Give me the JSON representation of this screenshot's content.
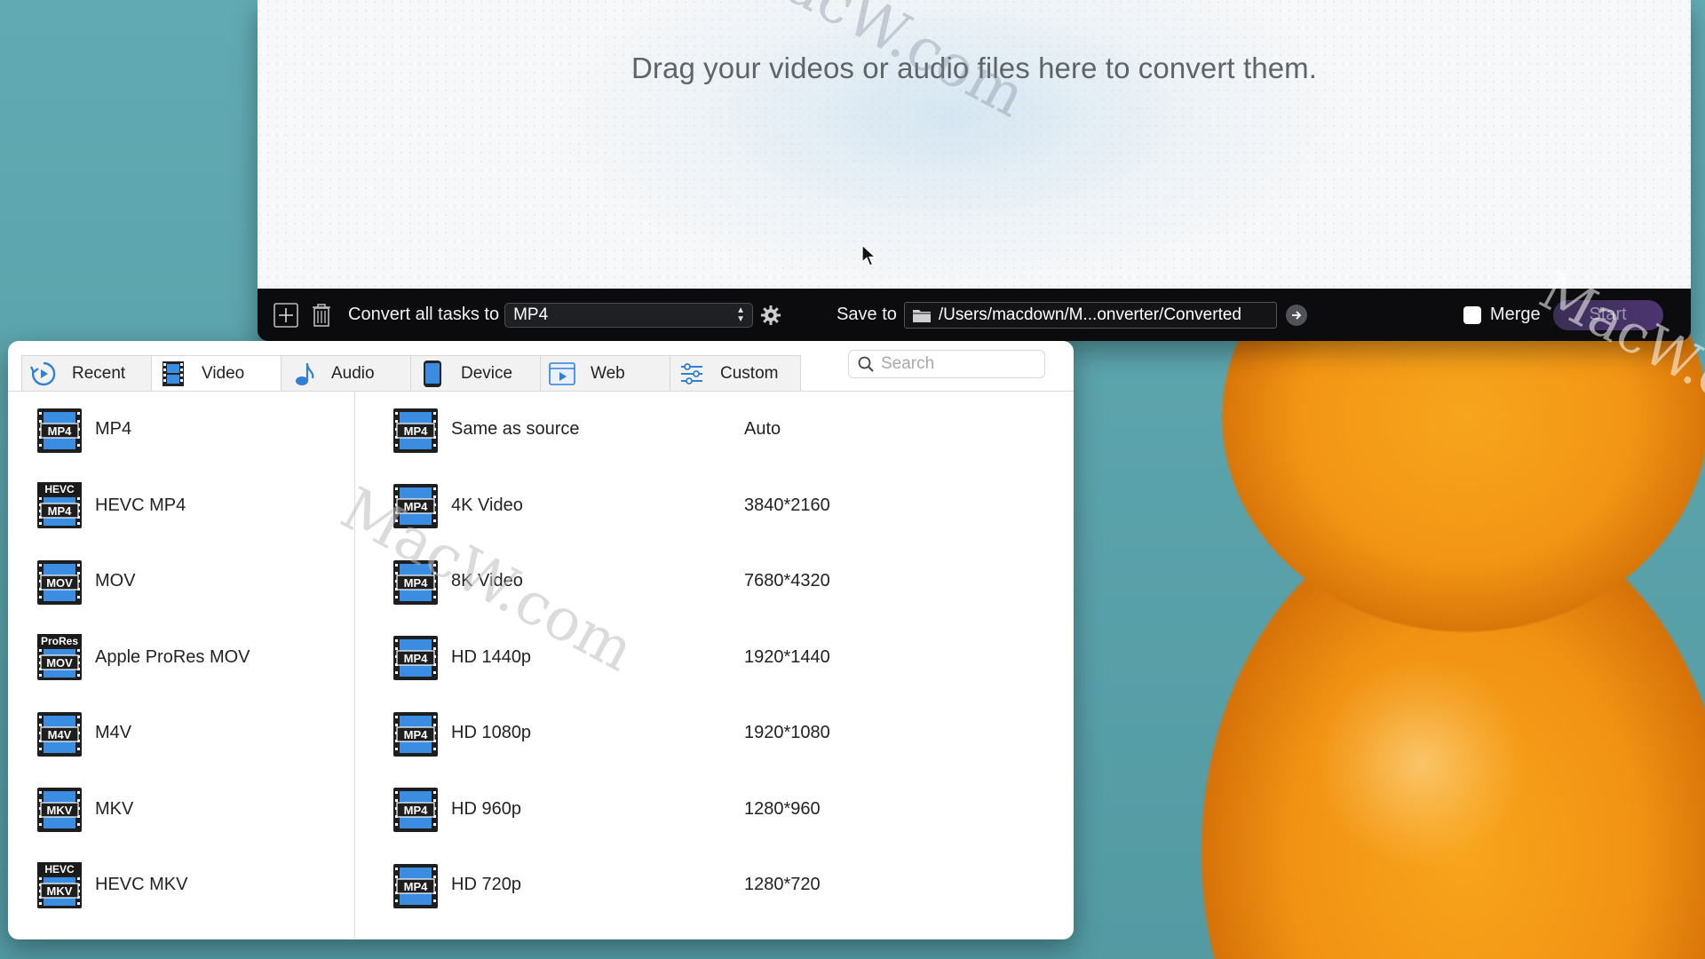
{
  "drop_zone": {
    "message": "Drag your videos or audio files here to convert them."
  },
  "toolbar": {
    "add_icon": "plus-square-icon",
    "delete_icon": "trash-icon",
    "convert_label": "Convert all tasks to",
    "convert_format": "MP4",
    "settings_icon": "gear-icon",
    "save_label": "Save to",
    "save_path": "/Users/macdown/M...onverter/Converted",
    "merge_label": "Merge",
    "start_label": "Start"
  },
  "tabs": [
    {
      "label": "Recent",
      "icon": "recent-icon",
      "active": false
    },
    {
      "label": "Video",
      "icon": "film-icon",
      "active": true
    },
    {
      "label": "Audio",
      "icon": "music-note-icon",
      "active": false
    },
    {
      "label": "Device",
      "icon": "phone-icon",
      "active": false
    },
    {
      "label": "Web",
      "icon": "web-video-icon",
      "active": false
    },
    {
      "label": "Custom",
      "icon": "sliders-icon",
      "active": false
    }
  ],
  "search": {
    "placeholder": "Search",
    "value": ""
  },
  "formats": [
    {
      "name": "MP4",
      "badge": "MP4",
      "top": ""
    },
    {
      "name": "HEVC MP4",
      "badge": "MP4",
      "top": "HEVC"
    },
    {
      "name": "MOV",
      "badge": "MOV",
      "top": ""
    },
    {
      "name": "Apple ProRes MOV",
      "badge": "MOV",
      "top": "ProRes"
    },
    {
      "name": "M4V",
      "badge": "M4V",
      "top": ""
    },
    {
      "name": "MKV",
      "badge": "MKV",
      "top": ""
    },
    {
      "name": "HEVC MKV",
      "badge": "MKV",
      "top": "HEVC"
    }
  ],
  "presets": [
    {
      "name": "Same as source",
      "resolution": "Auto",
      "badge": "MP4"
    },
    {
      "name": "4K Video",
      "resolution": "3840*2160",
      "badge": "MP4"
    },
    {
      "name": "8K Video",
      "resolution": "7680*4320",
      "badge": "MP4"
    },
    {
      "name": "HD 1440p",
      "resolution": "1920*1440",
      "badge": "MP4"
    },
    {
      "name": "HD 1080p",
      "resolution": "1920*1080",
      "badge": "MP4"
    },
    {
      "name": "HD 960p",
      "resolution": "1280*960",
      "badge": "MP4"
    },
    {
      "name": "HD 720p",
      "resolution": "1280*720",
      "badge": "MP4"
    }
  ],
  "colors": {
    "accent_blue": "#2f7fd6",
    "toolbar_bg": "#0c0c0e",
    "start_button": "#4d3570"
  },
  "watermark": "MacW.com"
}
